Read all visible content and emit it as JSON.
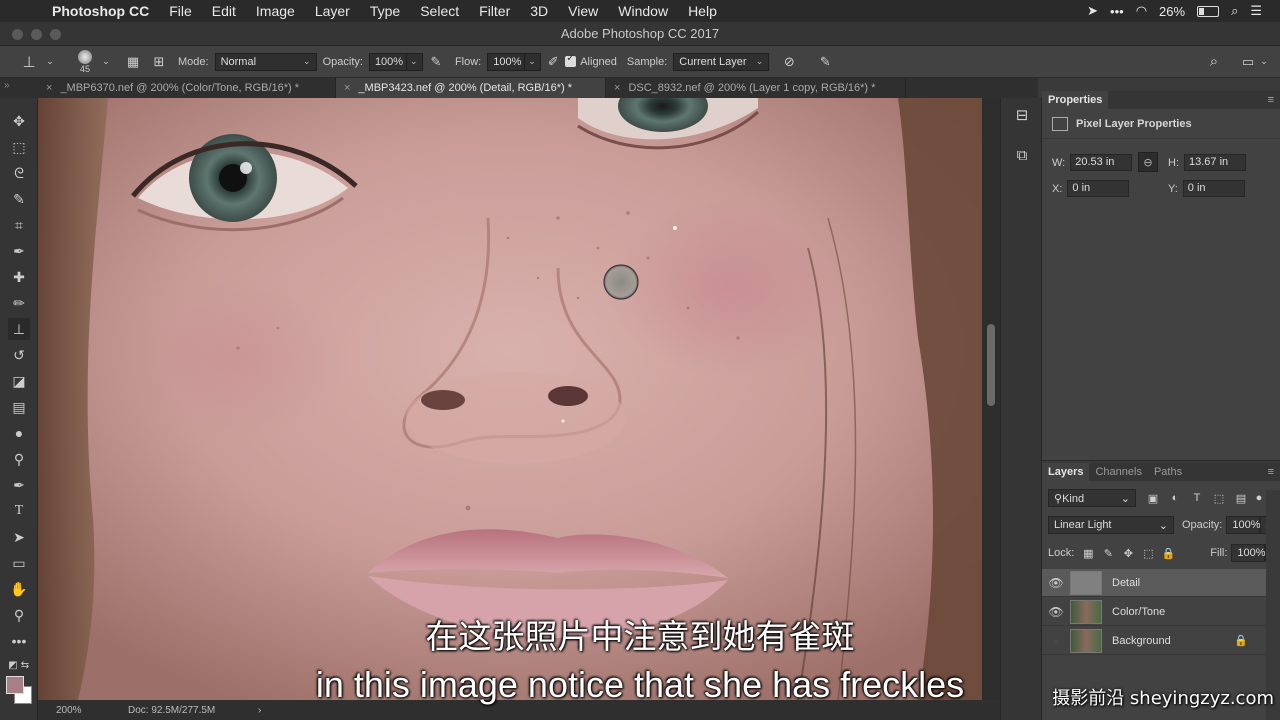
{
  "menubar": {
    "app": "Photoshop CC",
    "items": [
      "File",
      "Edit",
      "Image",
      "Layer",
      "Type",
      "Select",
      "Filter",
      "3D",
      "View",
      "Window",
      "Help"
    ],
    "dots": "•••",
    "battery_pct": "26%",
    "battery_level": 0.26
  },
  "window": {
    "title": "Adobe Photoshop CC 2017"
  },
  "options": {
    "brush_size": "45",
    "mode_label": "Mode:",
    "mode_value": "Normal",
    "opacity_label": "Opacity:",
    "opacity_value": "100%",
    "flow_label": "Flow:",
    "flow_value": "100%",
    "aligned_label": "Aligned",
    "sample_label": "Sample:",
    "sample_value": "Current Layer"
  },
  "tabs": [
    {
      "label": "_MBP6370.nef @ 200% (Color/Tone, RGB/16*) *"
    },
    {
      "label": "_MBP3423.nef @ 200% (Detail, RGB/16*) *"
    },
    {
      "label": "DSC_8932.nef @ 200% (Layer 1 copy, RGB/16*) *"
    }
  ],
  "status": {
    "zoom": "200%",
    "doc": "Doc: 92.5M/277.5M",
    "arrow": "›"
  },
  "properties": {
    "tab": "Properties",
    "heading": "Pixel Layer Properties",
    "w_label": "W:",
    "w_value": "20.53 in",
    "h_label": "H:",
    "h_value": "13.67 in",
    "x_label": "X:",
    "x_value": "0 in",
    "y_label": "Y:",
    "y_value": "0 in"
  },
  "layers": {
    "tabs": [
      "Layers",
      "Channels",
      "Paths"
    ],
    "kind": "Kind",
    "blend_mode": "Linear Light",
    "opacity_label": "Opacity:",
    "opacity_value": "100%",
    "lock_label": "Lock:",
    "fill_label": "Fill:",
    "fill_value": "100%",
    "items": [
      {
        "name": "Detail",
        "visible": true,
        "selected": true
      },
      {
        "name": "Color/Tone",
        "visible": true,
        "selected": false
      },
      {
        "name": "Background",
        "visible": false,
        "selected": false,
        "locked": true
      }
    ]
  },
  "subtitles": {
    "zh": "在这张照片中注意到她有雀斑",
    "en": "in this image notice that she has freckles"
  },
  "watermark": "摄影前沿 sheyingzyz.com",
  "colors": {
    "foreground": "#a87f86",
    "background": "#ffffff"
  }
}
